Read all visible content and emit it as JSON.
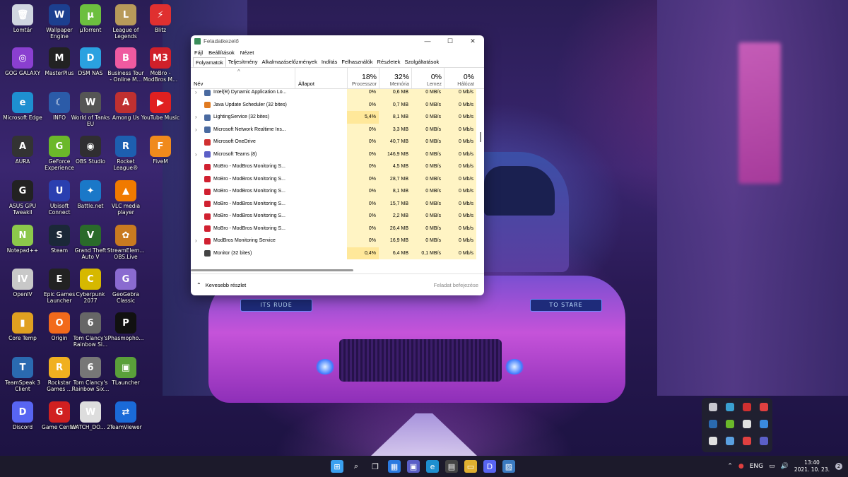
{
  "wallpaper": {
    "headlight_left_text": "ITS RUDE",
    "headlight_right_text": "TO STARE"
  },
  "desktop_icons": [
    {
      "label": "Lomtár",
      "color": "#d0d6e0",
      "glyph": "🗑",
      "col": 0,
      "row": 0
    },
    {
      "label": "Wallpaper Engine",
      "color": "#1c3f8f",
      "glyph": "W",
      "col": 1,
      "row": 0
    },
    {
      "label": "µTorrent",
      "color": "#6cbf3f",
      "glyph": "µ",
      "col": 2,
      "row": 0
    },
    {
      "label": "League of Legends",
      "color": "#b89a5a",
      "glyph": "L",
      "col": 3,
      "row": 0
    },
    {
      "label": "Blitz",
      "color": "#e03030",
      "glyph": "⚡",
      "col": 4,
      "row": 0
    },
    {
      "label": "GOG GALAXY",
      "color": "#8a3fd0",
      "glyph": "◎",
      "col": 0,
      "row": 1
    },
    {
      "label": "MasterPlus",
      "color": "#222",
      "glyph": "M",
      "col": 1,
      "row": 1
    },
    {
      "label": "DSM NAS",
      "color": "#2aa1e0",
      "glyph": "D",
      "col": 2,
      "row": 1
    },
    {
      "label": "Business Tour - Online M...",
      "color": "#ef5aa0",
      "glyph": "B",
      "col": 3,
      "row": 1
    },
    {
      "label": "MoBro - ModBros M...",
      "color": "#d0202a",
      "glyph": "M3",
      "col": 4,
      "row": 1
    },
    {
      "label": "Microsoft Edge",
      "color": "#1e8fd0",
      "glyph": "e",
      "col": 0,
      "row": 2
    },
    {
      "label": "INFO",
      "color": "#2b5ba8",
      "glyph": "☾",
      "col": 1,
      "row": 2
    },
    {
      "label": "World of Tanks EU",
      "color": "#555",
      "glyph": "W",
      "col": 2,
      "row": 2
    },
    {
      "label": "Among Us",
      "color": "#c03030",
      "glyph": "A",
      "col": 3,
      "row": 2
    },
    {
      "label": "YouTube Music",
      "color": "#e02020",
      "glyph": "▶",
      "col": 4,
      "row": 2
    },
    {
      "label": "AURA",
      "color": "#333",
      "glyph": "A",
      "col": 0,
      "row": 3
    },
    {
      "label": "GeForce Experience",
      "color": "#6bb82a",
      "glyph": "G",
      "col": 1,
      "row": 3
    },
    {
      "label": "OBS Studio",
      "color": "#302e31",
      "glyph": "◉",
      "col": 2,
      "row": 3
    },
    {
      "label": "Rocket League®",
      "color": "#1d5fb0",
      "glyph": "R",
      "col": 3,
      "row": 3
    },
    {
      "label": "FiveM",
      "color": "#f08a1c",
      "glyph": "F",
      "col": 4,
      "row": 3
    },
    {
      "label": "ASUS GPU Tweakll",
      "color": "#222",
      "glyph": "G",
      "col": 0,
      "row": 4
    },
    {
      "label": "Ubisoft Connect",
      "color": "#2a3fb0",
      "glyph": "U",
      "col": 1,
      "row": 4
    },
    {
      "label": "Battle.net",
      "color": "#1a78c8",
      "glyph": "✦",
      "col": 2,
      "row": 4
    },
    {
      "label": "VLC media player",
      "color": "#f07a00",
      "glyph": "▲",
      "col": 3,
      "row": 4
    },
    {
      "label": "Notepad++",
      "color": "#8cc84b",
      "glyph": "N",
      "col": 0,
      "row": 5
    },
    {
      "label": "Steam",
      "color": "#1b2838",
      "glyph": "S",
      "col": 1,
      "row": 5
    },
    {
      "label": "Grand Theft Auto V",
      "color": "#2a6a2a",
      "glyph": "V",
      "col": 2,
      "row": 5
    },
    {
      "label": "StreamElem... OBS.Live",
      "color": "#c97a20",
      "glyph": "✿",
      "col": 3,
      "row": 5
    },
    {
      "label": "OpenIV",
      "color": "#c8c8c8",
      "glyph": "IV",
      "col": 0,
      "row": 6
    },
    {
      "label": "Epic Games Launcher",
      "color": "#222",
      "glyph": "E",
      "col": 1,
      "row": 6
    },
    {
      "label": "Cyberpunk 2077",
      "color": "#d6b800",
      "glyph": "C",
      "col": 2,
      "row": 6
    },
    {
      "label": "GeoGebra Classic",
      "color": "#8a6bd0",
      "glyph": "G",
      "col": 3,
      "row": 6
    },
    {
      "label": "Core Temp",
      "color": "#e0a020",
      "glyph": "▮",
      "col": 0,
      "row": 7
    },
    {
      "label": "Origin",
      "color": "#f26a1b",
      "glyph": "O",
      "col": 1,
      "row": 7
    },
    {
      "label": "Tom Clancy's Rainbow Si...",
      "color": "#666",
      "glyph": "6",
      "col": 2,
      "row": 7
    },
    {
      "label": "Phasmopho...",
      "color": "#111",
      "glyph": "P",
      "col": 3,
      "row": 7
    },
    {
      "label": "TeamSpeak 3 Client",
      "color": "#2a6ab0",
      "glyph": "T",
      "col": 0,
      "row": 8
    },
    {
      "label": "Rockstar Games ...",
      "color": "#f0b020",
      "glyph": "R",
      "col": 1,
      "row": 8
    },
    {
      "label": "Tom Clancy's Rainbow Six...",
      "color": "#777",
      "glyph": "6",
      "col": 2,
      "row": 8
    },
    {
      "label": "TLauncher",
      "color": "#5aa03a",
      "glyph": "▣",
      "col": 3,
      "row": 8
    },
    {
      "label": "Discord",
      "color": "#5865f2",
      "glyph": "D",
      "col": 0,
      "row": 9
    },
    {
      "label": "Game Center",
      "color": "#d02020",
      "glyph": "G",
      "col": 1,
      "row": 9
    },
    {
      "label": "WATCH_DO... 2",
      "color": "#ddd",
      "glyph": "W",
      "col": 2,
      "row": 9
    },
    {
      "label": "TeamViewer",
      "color": "#1a6ad8",
      "glyph": "⇄",
      "col": 3,
      "row": 9
    }
  ],
  "task_manager": {
    "title": "Feladatkezelő",
    "menu": [
      "Fájl",
      "Beállítások",
      "Nézet"
    ],
    "tabs": [
      "Folyamatok",
      "Teljesítmény",
      "Alkalmazáselőzmények",
      "Indítás",
      "Felhasználók",
      "Részletek",
      "Szolgáltatások"
    ],
    "active_tab": "Folyamatok",
    "columns": {
      "name": "Név",
      "status": "Állapot",
      "cpu": {
        "pct": "18%",
        "label": "Processzor"
      },
      "mem": {
        "pct": "32%",
        "label": "Memória"
      },
      "disk": {
        "pct": "0%",
        "label": "Lemez"
      },
      "net": {
        "pct": "0%",
        "label": "Hálózat"
      }
    },
    "rows": [
      {
        "expandable": true,
        "icon": "#4a6aa0",
        "name": "Intel(R) Dynamic Application Lo...",
        "cpu": "0%",
        "mem": "0,6 MB",
        "disk": "0 MB/s",
        "net": "0 Mb/s",
        "hot": false
      },
      {
        "expandable": false,
        "icon": "#e07a20",
        "name": "Java Update Scheduler (32 bites)",
        "cpu": "0%",
        "mem": "0,7 MB",
        "disk": "0 MB/s",
        "net": "0 Mb/s",
        "hot": false
      },
      {
        "expandable": true,
        "icon": "#4a6aa0",
        "name": "LightingService (32 bites)",
        "cpu": "5,4%",
        "mem": "8,1 MB",
        "disk": "0 MB/s",
        "net": "0 Mb/s",
        "hot": true
      },
      {
        "expandable": true,
        "icon": "#4a6aa0",
        "name": "Microsoft Network Realtime Ins...",
        "cpu": "0%",
        "mem": "3,3 MB",
        "disk": "0 MB/s",
        "net": "0 Mb/s",
        "hot": false
      },
      {
        "expandable": false,
        "icon": "#d03030",
        "name": "Microsoft OneDrive",
        "cpu": "0%",
        "mem": "40,7 MB",
        "disk": "0 MB/s",
        "net": "0 Mb/s",
        "hot": false
      },
      {
        "expandable": true,
        "icon": "#5b5fc7",
        "name": "Microsoft Teams (8)",
        "cpu": "0%",
        "mem": "146,9 MB",
        "disk": "0 MB/s",
        "net": "0 Mb/s",
        "hot": false
      },
      {
        "expandable": false,
        "icon": "#d02030",
        "name": "MoBro - ModBros Monitoring S...",
        "cpu": "0%",
        "mem": "4,5 MB",
        "disk": "0 MB/s",
        "net": "0 Mb/s",
        "hot": false
      },
      {
        "expandable": false,
        "icon": "#d02030",
        "name": "MoBro - ModBros Monitoring S...",
        "cpu": "0%",
        "mem": "28,7 MB",
        "disk": "0 MB/s",
        "net": "0 Mb/s",
        "hot": false
      },
      {
        "expandable": false,
        "icon": "#d02030",
        "name": "MoBro - ModBros Monitoring S...",
        "cpu": "0%",
        "mem": "8,1 MB",
        "disk": "0 MB/s",
        "net": "0 Mb/s",
        "hot": false
      },
      {
        "expandable": false,
        "icon": "#d02030",
        "name": "MoBro - ModBros Monitoring S...",
        "cpu": "0%",
        "mem": "15,7 MB",
        "disk": "0 MB/s",
        "net": "0 Mb/s",
        "hot": false
      },
      {
        "expandable": false,
        "icon": "#d02030",
        "name": "MoBro - ModBros Monitoring S...",
        "cpu": "0%",
        "mem": "2,2 MB",
        "disk": "0 MB/s",
        "net": "0 Mb/s",
        "hot": false
      },
      {
        "expandable": false,
        "icon": "#d02030",
        "name": "MoBro - ModBros Monitoring S...",
        "cpu": "0%",
        "mem": "26,4 MB",
        "disk": "0 MB/s",
        "net": "0 Mb/s",
        "hot": false
      },
      {
        "expandable": true,
        "icon": "#d02030",
        "name": "ModBros Monitoring Service",
        "cpu": "0%",
        "mem": "16,9 MB",
        "disk": "0 MB/s",
        "net": "0 Mb/s",
        "hot": false
      },
      {
        "expandable": false,
        "icon": "#444",
        "name": "Monitor (32 bites)",
        "cpu": "0,4%",
        "mem": "6,4 MB",
        "disk": "0,1 MB/s",
        "net": "0 Mb/s",
        "hot": true
      }
    ],
    "footer": {
      "less_details": "Kevesebb részlet",
      "end_task": "Feladat befejezése"
    }
  },
  "tray_flyout": [
    {
      "name": "tray-icon-1",
      "color": "#c8c8d0"
    },
    {
      "name": "tray-icon-2",
      "color": "#3aa0d0"
    },
    {
      "name": "tray-icon-3",
      "color": "#d03030"
    },
    {
      "name": "tray-icon-4",
      "color": "#e04040"
    },
    {
      "name": "tray-icon-5",
      "color": "#2a6ab0"
    },
    {
      "name": "tray-icon-6",
      "color": "#6bb82a"
    },
    {
      "name": "tray-icon-7",
      "color": "#e0e0e0"
    },
    {
      "name": "tray-icon-8",
      "color": "#3a8ae0"
    },
    {
      "name": "tray-icon-9",
      "color": "#e0e0e0"
    },
    {
      "name": "tray-icon-10",
      "color": "#5aa0e0"
    },
    {
      "name": "tray-icon-11",
      "color": "#e04040"
    },
    {
      "name": "tray-icon-12",
      "color": "#5b5fc7"
    }
  ],
  "taskbar": {
    "pinned": [
      {
        "name": "start-icon",
        "glyph": "⊞",
        "color": "#3aa0f0"
      },
      {
        "name": "search-icon",
        "glyph": "⌕",
        "color": "transparent"
      },
      {
        "name": "task-view-icon",
        "glyph": "❐",
        "color": "transparent"
      },
      {
        "name": "widgets-icon",
        "glyph": "▦",
        "color": "#2a7ae0"
      },
      {
        "name": "chat-icon",
        "glyph": "▣",
        "color": "#5b5fc7"
      },
      {
        "name": "edge-icon",
        "glyph": "e",
        "color": "#1e8fd0"
      },
      {
        "name": "store-icon",
        "glyph": "▤",
        "color": "#444"
      },
      {
        "name": "file-explorer-icon",
        "glyph": "▭",
        "color": "#e0b030"
      },
      {
        "name": "discord-icon",
        "glyph": "D",
        "color": "#5865f2"
      },
      {
        "name": "photos-icon",
        "glyph": "▨",
        "color": "#3a7ac0"
      }
    ],
    "language": "ENG",
    "time": "13:40",
    "date": "2021. 10. 23.",
    "notification_count": "2"
  }
}
